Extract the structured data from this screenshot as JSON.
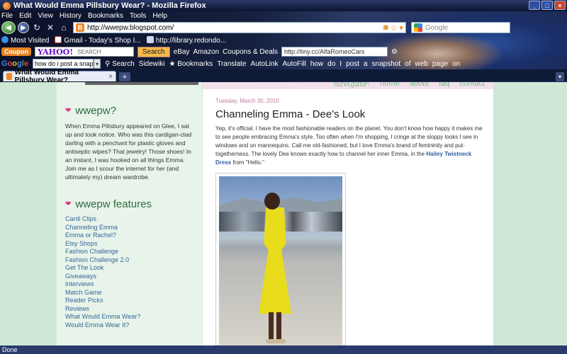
{
  "window": {
    "title": "What Would Emma Pillsbury Wear? - Mozilla Firefox",
    "minimize": "_",
    "maximize": "□",
    "close": "×"
  },
  "menu": [
    "File",
    "Edit",
    "View",
    "History",
    "Bookmarks",
    "Tools",
    "Help"
  ],
  "navigation": {
    "url": "http://wwepw.blogspot.com/",
    "search_placeholder": "Google",
    "back_icon": "back-arrow-icon",
    "forward_icon": "forward-arrow-icon",
    "reload_icon": "reload-icon",
    "home_icon": "home-icon"
  },
  "bookmarks": [
    {
      "label": "Most Visited",
      "icon": "ie-icon"
    },
    {
      "label": "Gmail - Today's Shop I...",
      "icon": "gmail-icon"
    },
    {
      "label": "http://library.redondo...",
      "icon": "page-icon"
    }
  ],
  "yahoo_toolbar": {
    "badge": "Coupon",
    "logo": "YAHOO!",
    "search_label": "SEARCH",
    "button": "Search",
    "links": [
      "eBay",
      "Amazon",
      "Coupons & Deals"
    ],
    "tiny_url": "http://tiny.cc/AlfaRomeoCars"
  },
  "google_toolbar": {
    "logo": "Google",
    "query": "how do i post a snapsh",
    "search_button": "Search",
    "items": [
      "Sidewiki",
      "Bookmarks",
      "Translate",
      "AutoLink",
      "AutoFill",
      "how",
      "do",
      "I",
      "post",
      "a",
      "snapshot",
      "of",
      "web",
      "page",
      "on"
    ]
  },
  "tabs": [
    {
      "label": "What Would Emma Pillsbury Wear?"
    }
  ],
  "new_tab": "+",
  "blog": {
    "nav_links": [
      "navigate:",
      "home",
      "about",
      "faq",
      "contact"
    ],
    "sidebar": {
      "intro_title": "wwepw?",
      "intro_text": "When Emma Pillsbury appeared on Glee, I sat up and took notice. Who was this cardigan-clad darling with a penchant for plastic gloves and antiseptic wipes? That jewelry! Those shoes! In an instant, I was hooked on all things Emma. Join me as I scour the internet for her (and ultimately my) dream wardrobe.",
      "features_title": "wwepw features",
      "features": [
        "Cardi Clips",
        "Channeling Emma",
        "Emma or Rachel?",
        "Etsy Shops",
        "Fashion Challenge",
        "Fashion Challenge 2.0",
        "Get The Look",
        "Giveaways",
        "Interviews",
        "Match Game",
        "Reader Picks",
        "Reviews",
        "What Would Emma Wear?",
        "Would Emma Wear It?"
      ]
    },
    "post": {
      "date": "Tuesday, March 30, 2010",
      "title": "Channeling Emma - Dee's Look",
      "body_before": "Yep, it's official. I have the most fashionable readers on the planet. You don't know how happy it makes me to see people embracing Emma's style. Too often when I'm shopping, I cringe at the sloppy looks I see in windows and on mannequins. Call me old-fashioned, but I love Emma's brand of femininity and put-togetherness. The lovely Dee knows exactly how to channel her inner Emma, in the ",
      "body_link": "Hailey Twistneck Dress",
      "body_after": " from \"Hello.\""
    }
  },
  "status": "Done",
  "colors": {
    "sidebar_bg": "#e8f4ea",
    "page_bg": "#cfe8d6",
    "accent_pink": "#e0357b",
    "link_blue": "#336699",
    "dress_yellow": "#e8dc1c"
  }
}
